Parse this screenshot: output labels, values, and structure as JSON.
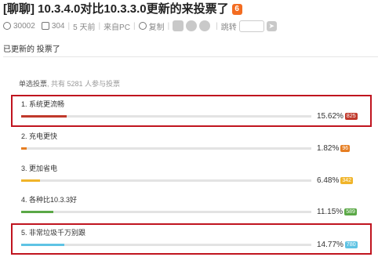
{
  "post": {
    "title": "[聊聊] 10.3.4.0对比10.3.3.0更新的来投票了",
    "title_icon": "fire-icon",
    "title_icon_glyph": "6"
  },
  "meta": {
    "views": "30002",
    "replies": "304",
    "time": "5 天前",
    "source": "来自PC",
    "copy": "复制",
    "jump": "跳转",
    "sep": "|"
  },
  "updated_text": "已更新的 投票了",
  "vote": {
    "label": "单选投票",
    "participants": ", 共有 5281 人参与投票",
    "options": [
      {
        "label": "1. 系统更流畅",
        "percent_text": "15.62%",
        "count": "825",
        "percent": 15.62,
        "color": "#c0392b"
      },
      {
        "label": "2. 充电更快",
        "percent_text": "1.82%",
        "count": "96",
        "percent": 1.82,
        "color": "#e67e22"
      },
      {
        "label": "3. 更加省电",
        "percent_text": "6.48%",
        "count": "342",
        "percent": 6.48,
        "color": "#f0b429"
      },
      {
        "label": "4. 各种比10.3.3好",
        "percent_text": "11.15%",
        "count": "589",
        "percent": 11.15,
        "color": "#5aa846"
      },
      {
        "label": "5. 非常垃圾千万别跟",
        "percent_text": "14.77%",
        "count": "780",
        "percent": 14.77,
        "color": "#5fc3e4"
      }
    ]
  }
}
